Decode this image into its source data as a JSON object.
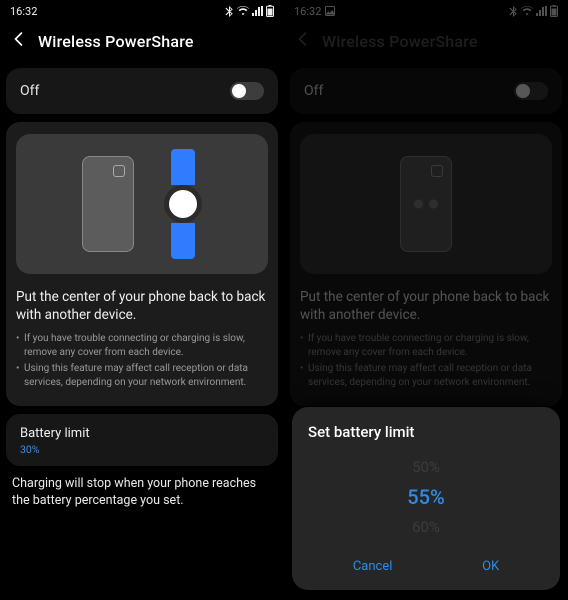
{
  "status": {
    "time": "16:32",
    "icons_left": [
      "image-icon"
    ],
    "icons_right": [
      "bluetooth-icon",
      "wifi-icon",
      "signal-icon",
      "battery-icon"
    ]
  },
  "header": {
    "title": "Wireless PowerShare"
  },
  "toggle": {
    "label": "Off",
    "value": false
  },
  "instruction": {
    "title": "Put the center of your phone back to back with another device.",
    "bullets": [
      "If you have trouble connecting or charging is slow, remove any cover from each device.",
      "Using this feature may affect call reception or data services, depending on your network environment."
    ]
  },
  "battery_limit": {
    "label": "Battery limit",
    "value": "30%",
    "description": "Charging will stop when your phone reaches the battery percentage you set."
  },
  "dialog": {
    "title": "Set battery limit",
    "options": [
      "50%",
      "55%",
      "60%"
    ],
    "selected": 1,
    "cancel": "Cancel",
    "ok": "OK"
  }
}
